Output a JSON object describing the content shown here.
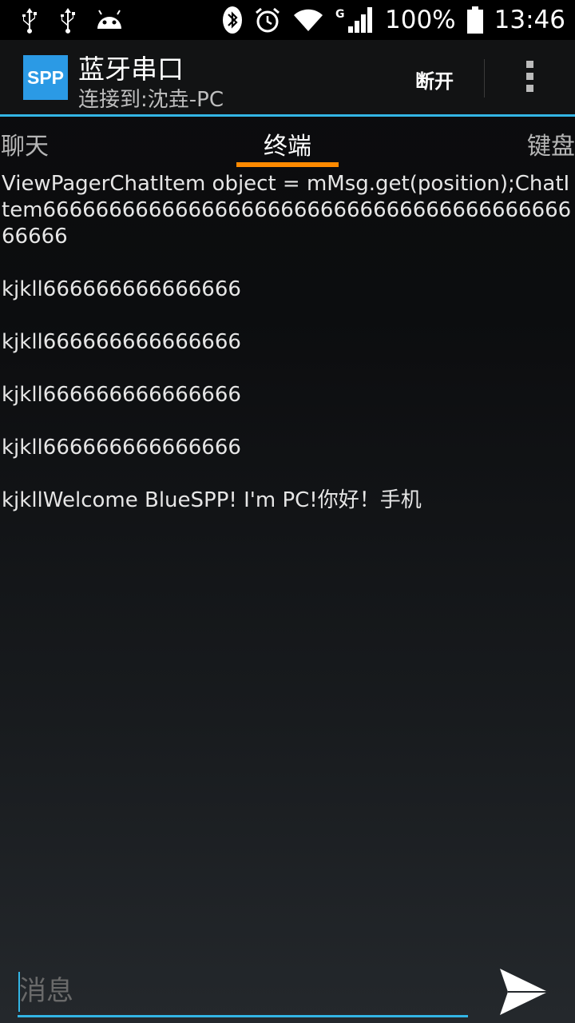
{
  "status_bar": {
    "icons_left": [
      "usb-icon",
      "usb-icon",
      "android-debug-icon"
    ],
    "icons_right": [
      "bluetooth-icon",
      "alarm-icon",
      "wifi-icon",
      "signal-icon",
      "battery-icon"
    ],
    "network_type": "G",
    "battery": "100%",
    "time": "13:46"
  },
  "action_bar": {
    "logo_text": "SPP",
    "title": "蓝牙串口",
    "subtitle": "连接到:沈垚-PC",
    "disconnect_label": "断开",
    "overflow_icon": "overflow-menu-icon"
  },
  "tabs": [
    {
      "label": "聊天",
      "selected": false
    },
    {
      "label": "终端",
      "selected": true
    },
    {
      "label": "键盘",
      "selected": false
    }
  ],
  "messages": [
    "ViewPagerChatItem object = mMsg.get(position);ChatItem666666666666666666666666666666666666666666666",
    "kjkll666666666666666",
    "kjkll666666666666666",
    "kjkll666666666666666",
    "kjkll666666666666666",
    "kjkllWelcome BlueSPP! I'm PC!你好！手机"
  ],
  "composer": {
    "placeholder": "消息",
    "send_icon": "send-icon"
  },
  "colors": {
    "accent_blue": "#33b5e5",
    "tab_indicator": "#ff8a00",
    "logo_bg": "#2b9ae5"
  }
}
